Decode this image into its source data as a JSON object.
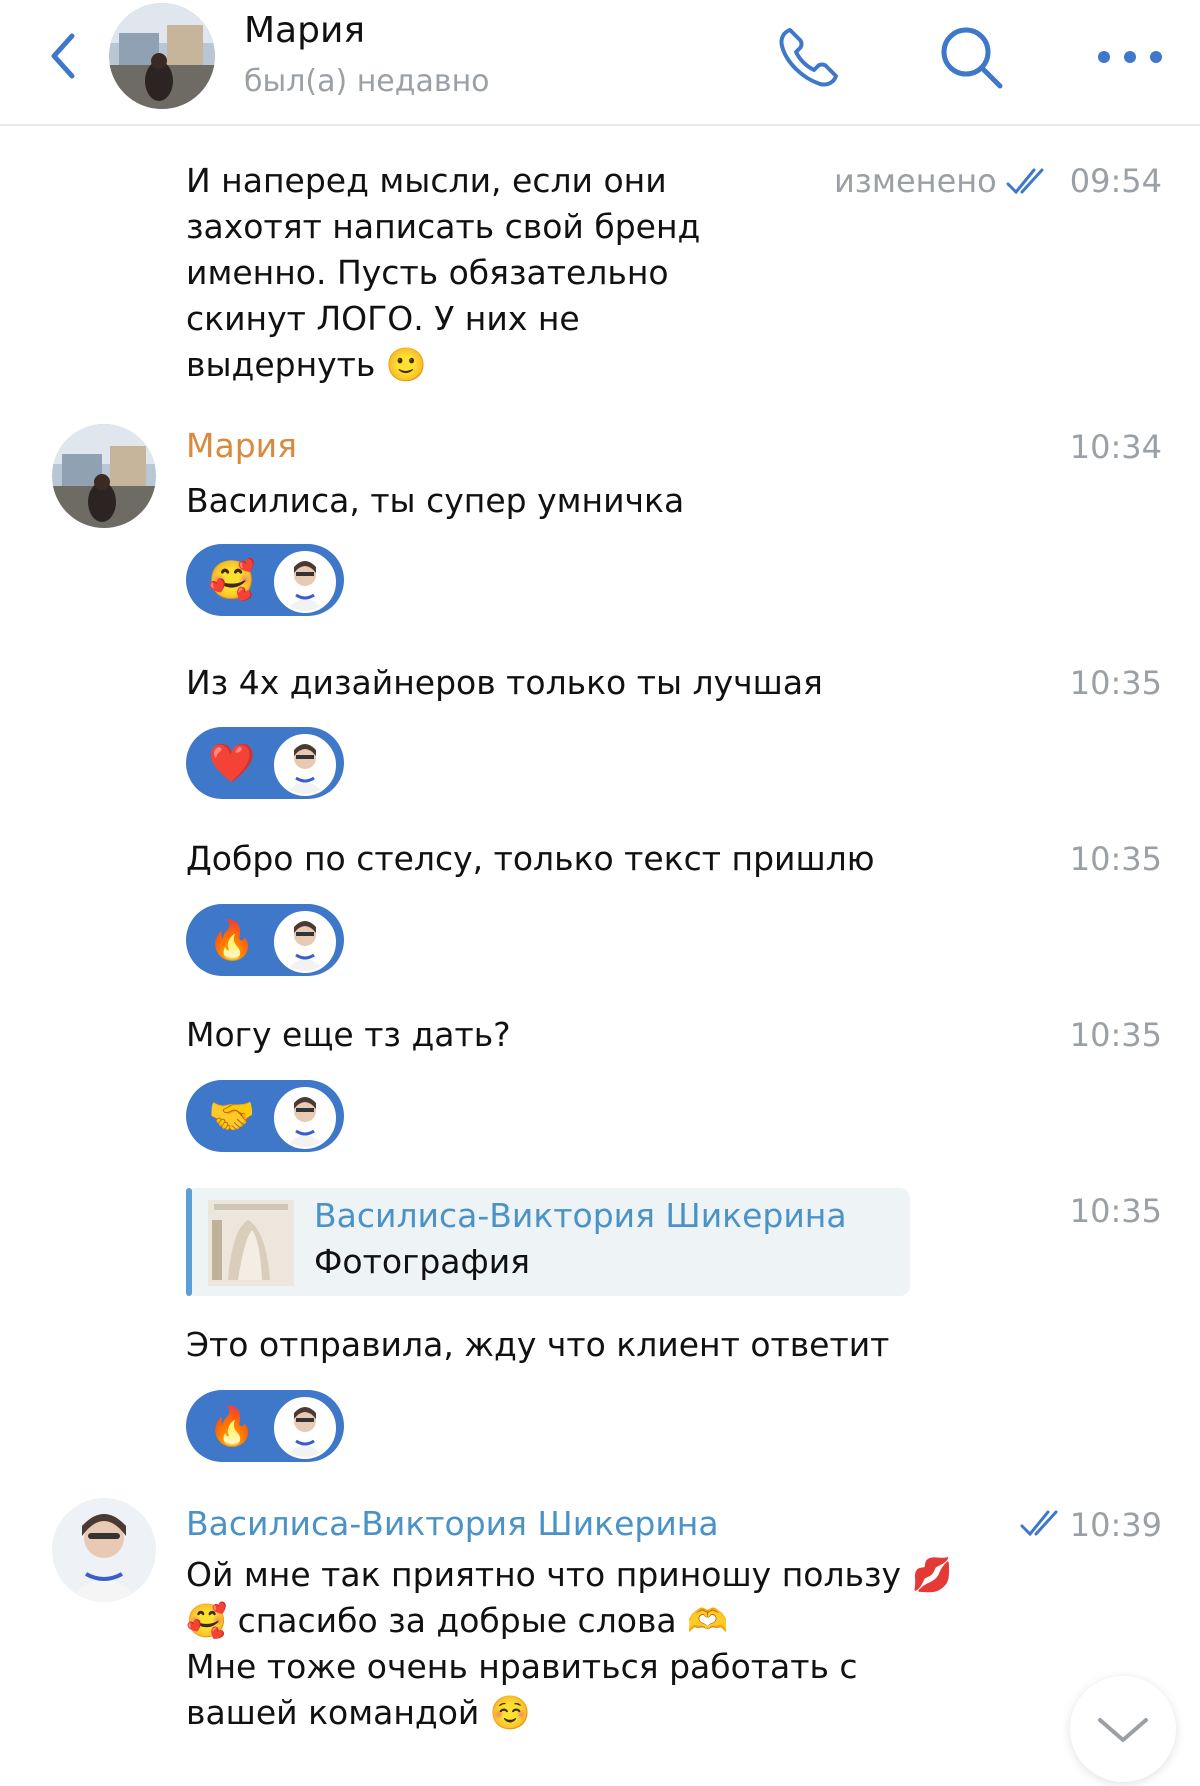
{
  "header": {
    "name": "Мария",
    "status": "был(а) недавно"
  },
  "messages": [
    {
      "text": "И наперед мысли, если они\nзахотят написать свой бренд\nименно. Пусть обязательно\nскинут ЛОГО. У них не\nвыдернуть 🙂",
      "edited": "изменено",
      "time": "09:54"
    },
    {
      "sender": "Мария",
      "text": "Василиса, ты супер умничка",
      "time": "10:34",
      "reaction": "🥰"
    },
    {
      "text": "Из 4х дизайнеров только ты лучшая",
      "time": "10:35",
      "reaction": "❤️"
    },
    {
      "text": "Добро по стелсу, только текст пришлю",
      "time": "10:35",
      "reaction": "🔥"
    },
    {
      "text": "Могу еще тз дать?",
      "time": "10:35",
      "reaction": "🤝"
    },
    {
      "forward_name": "Василиса-Виктория Шикерина",
      "forward_type": "Фотография",
      "time": "10:35"
    },
    {
      "text": "Это отправила, жду что клиент ответит",
      "reaction": "🔥"
    },
    {
      "sender": "Василиса-Виктория Шикерина",
      "text": "Ой мне так приятно что приношу пользу 💋\n🥰 спасибо за добрые слова 🫶\nМне тоже очень нравиться работать с\nвашей командой ☺️",
      "time": "10:39"
    }
  ],
  "colors": {
    "accent": "#3f78c9",
    "maria_name": "#d98a3e",
    "vasilisa_name": "#4b93c7",
    "time_gray": "#9aa0a6"
  }
}
